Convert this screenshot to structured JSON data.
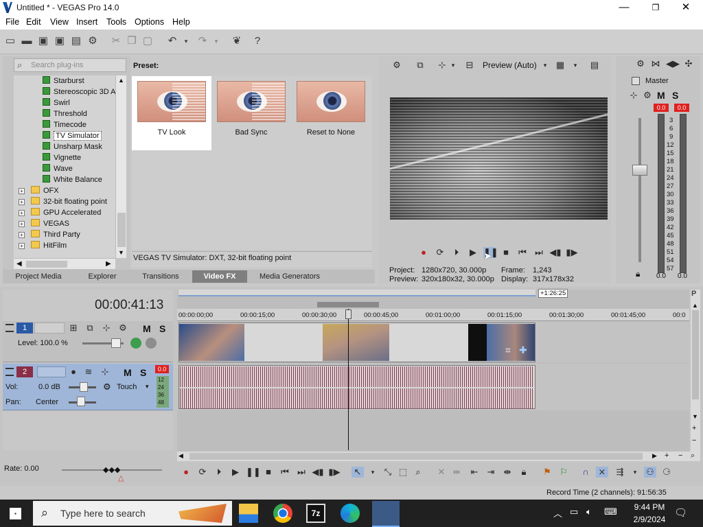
{
  "window": {
    "title": "Untitled * - VEGAS Pro 14.0",
    "minimize": "—",
    "maximize": "❐",
    "close": "✕"
  },
  "menu": [
    "File",
    "Edit",
    "View",
    "Insert",
    "Tools",
    "Options",
    "Help"
  ],
  "plugin_browser": {
    "search_placeholder": "Search plug-ins",
    "effects": [
      "Starburst",
      "Stereoscopic 3D A",
      "Swirl",
      "Threshold",
      "Timecode",
      "TV Simulator",
      "Unsharp Mask",
      "Vignette",
      "Wave",
      "White Balance"
    ],
    "selected_effect": "TV Simulator",
    "folders": [
      "OFX",
      "32-bit floating point",
      "GPU Accelerated",
      "VEGAS",
      "Third Party",
      "HitFilm"
    ]
  },
  "presets": {
    "label": "Preset:",
    "items": [
      "TV Look",
      "Bad Sync",
      "Reset to None"
    ],
    "selected": "TV Look",
    "status": "VEGAS TV Simulator: DXT, 32-bit floating point"
  },
  "tabs": [
    "Project Media",
    "Explorer",
    "Transitions",
    "Video FX",
    "Media Generators"
  ],
  "active_tab": "Video FX",
  "preview": {
    "quality": "Preview (Auto)",
    "project_label": "Project:",
    "project_value": "1280x720, 30.000p",
    "preview_label": "Preview:",
    "preview_value": "320x180x32, 30.000p",
    "frame_label": "Frame:",
    "frame_value": "1,243",
    "display_label": "Display:",
    "display_value": "317x178x32"
  },
  "master": {
    "title": "Master",
    "peak_left": "0.0",
    "peak_right": "0.0",
    "scale": [
      "3",
      "6",
      "9",
      "12",
      "15",
      "18",
      "21",
      "24",
      "27",
      "30",
      "33",
      "36",
      "39",
      "42",
      "45",
      "48",
      "51",
      "54",
      "57"
    ],
    "level_left": "0.0",
    "level_right": "0.0"
  },
  "timeline": {
    "time": "00:00:41:13",
    "region_length": "+1:26:25",
    "ruler": [
      "00:00:00;00",
      "00:00:15;00",
      "00:00:30;00",
      "00:00:45;00",
      "00:01:00;00",
      "00:01:15;00",
      "00:01:30;00",
      "00:01:45;00",
      "00:0"
    ],
    "video_track": {
      "number": "1",
      "level_label": "Level: 100.0 %"
    },
    "audio_track": {
      "number": "2",
      "peak": "0.0",
      "vol_label": "Vol:",
      "vol_value": "0.0 dB",
      "pan_label": "Pan:",
      "pan_value": "Center",
      "mode": "Touch",
      "meter_scale": [
        "12",
        "24",
        "36",
        "48"
      ]
    },
    "rate_label": "Rate: 0.00",
    "record_time": "Record Time (2 channels): 91:56:35"
  },
  "taskbar": {
    "search_placeholder": "Type here to search",
    "time": "9:44 PM",
    "date": "2/9/2024"
  },
  "colors": {
    "accent": "#8b2e47",
    "selected_tab": "#7f7f7f",
    "track_blue": "#9fb6d8",
    "meter_red": "#e02020"
  }
}
